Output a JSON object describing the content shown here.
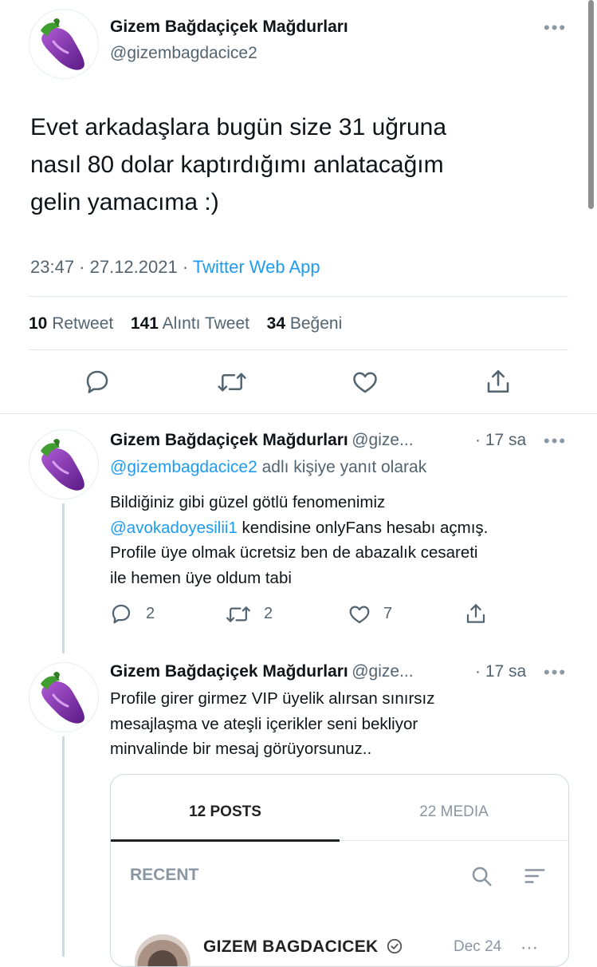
{
  "main_tweet": {
    "author_name": "Gizem Bağdaçiçek Mağdurları",
    "author_handle": "@gizembagdacice2",
    "avatar_emoji": "eggplant-icon",
    "text_lines": [
      "Evet arkadaşlara bugün size 31 uğruna",
      "nasıl 80 dolar kaptırdığımı anlatacağım",
      "gelin yamacıma :)"
    ],
    "time": "23:47 · 27.12.2021 · ",
    "source": "Twitter Web App",
    "stats": {
      "retweets_count": "10",
      "retweets_label": " Retweet",
      "quotes_count": "141",
      "quotes_label": " Alıntı Tweet",
      "likes_count": "34",
      "likes_label": " Beğeni"
    },
    "actions": [
      "reply-icon",
      "retweet-icon",
      "like-icon",
      "share-icon"
    ]
  },
  "reply_1": {
    "author_name": "Gizem Bağdaçiçek Mağdurları",
    "author_handle": "@gize...",
    "time": "· 17 sa",
    "replying_to_handle": "@gizembagdacice2",
    "replying_to_suffix": " adlı kişiye yanıt olarak",
    "text_line_1": "Bildiğiniz gibi güzel götlü fenomenimiz",
    "mention": "@avokadoyesilii1",
    "text_line_2_rest": " kendisine onlyFans hesabı açmış.",
    "text_line_3": "Profile üye olmak ücretsiz ben de abazalık cesareti",
    "text_line_4": "ile hemen üye oldum tabi",
    "reply_count": "2",
    "retweet_count": "2",
    "like_count": "7"
  },
  "reply_2": {
    "author_name": "Gizem Bağdaçiçek Mağdurları",
    "author_handle": "@gize...",
    "time": "· 17 sa",
    "text_lines": [
      "Profile girer girmez VIP üyelik alırsan sınırsız",
      "mesajlaşma ve ateşli içerikler seni bekliyor",
      "minvalinde bir mesaj görüyorsunuz.."
    ]
  },
  "embedded_card": {
    "tabs": [
      "12 POSTS",
      "22 MEDIA"
    ],
    "active_tab": 0,
    "section_label": "RECENT",
    "post_author": "GIZEM BAGDACICEK",
    "post_date": "Dec 24",
    "accent_color": "#1d9bf0"
  }
}
